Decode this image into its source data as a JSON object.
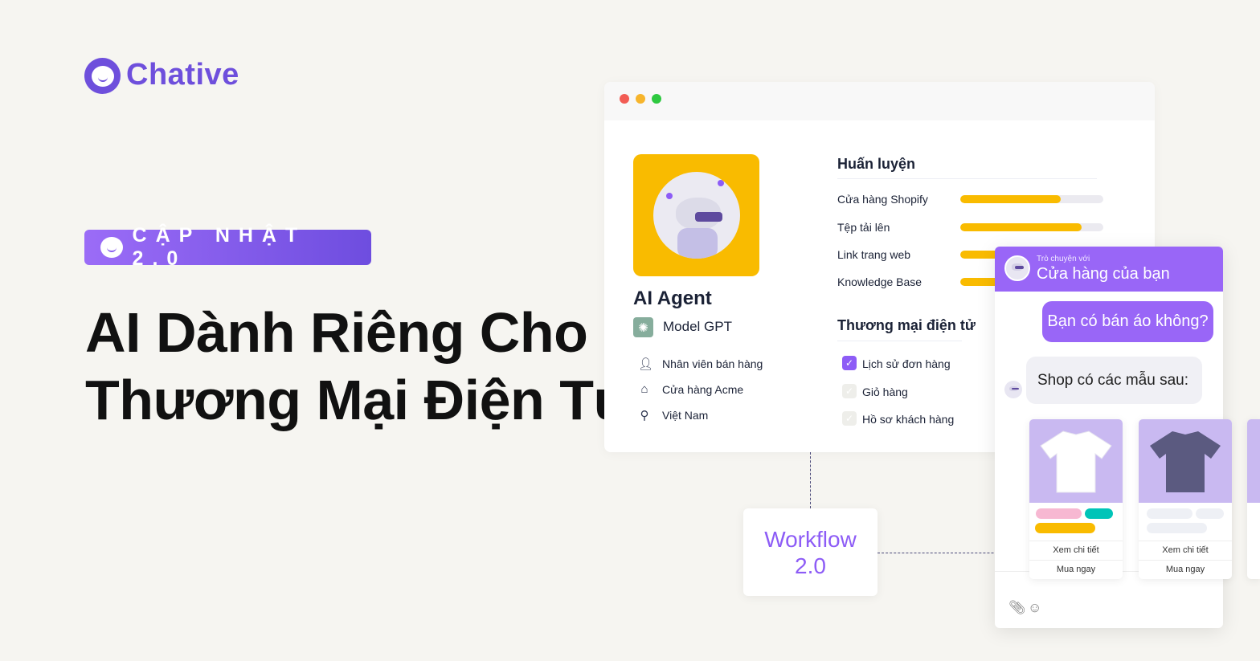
{
  "brand": {
    "name": "Chative",
    "color": "#6e4fdc"
  },
  "badge": {
    "label": "CẬP NHẬT 2.0"
  },
  "headline": {
    "line1": "AI Dành Riêng Cho",
    "line2": "Thương Mại Điện Tử"
  },
  "agent": {
    "title": "AI Agent",
    "model": "Model GPT",
    "info": [
      {
        "icon": "user-icon",
        "label": "Nhân viên bán hàng"
      },
      {
        "icon": "home-icon",
        "label": "Cửa hàng Acme"
      },
      {
        "icon": "location-pin-icon",
        "label": "Việt Nam"
      }
    ]
  },
  "training": {
    "title": "Huấn luyện",
    "items": [
      {
        "label": "Cửa hàng Shopify",
        "progress": 0.7
      },
      {
        "label": "Tệp tải lên",
        "progress": 0.85
      },
      {
        "label": "Link trang web"
      },
      {
        "label": "Knowledge Base"
      }
    ]
  },
  "ecommerce": {
    "title": "Thương mại điện tử",
    "items": [
      {
        "label": "Lịch sử đơn hàng",
        "checked": true
      },
      {
        "label": "Giỏ hàng",
        "checked": false
      },
      {
        "label": "Hồ sơ khách hàng",
        "checked": false
      }
    ]
  },
  "workflow": {
    "line1": "Workflow",
    "line2": "2.0"
  },
  "chat": {
    "subtitle": "Trò chuyện với",
    "title": "Cửa hàng của bạn",
    "user_message": "Bạn có bán áo không?",
    "bot_message": "Shop có các mẫu sau:",
    "cards": [
      {
        "view": "Xem chi tiết",
        "buy": "Mua ngay",
        "shirt_color": "#ffffff"
      },
      {
        "view": "Xem chi tiết",
        "buy": "Mua ngay",
        "shirt_color": "#5b5a80"
      }
    ]
  },
  "colors": {
    "accent": "#9966f7",
    "yellow": "#f9bb00",
    "background": "#f6f5f1"
  }
}
